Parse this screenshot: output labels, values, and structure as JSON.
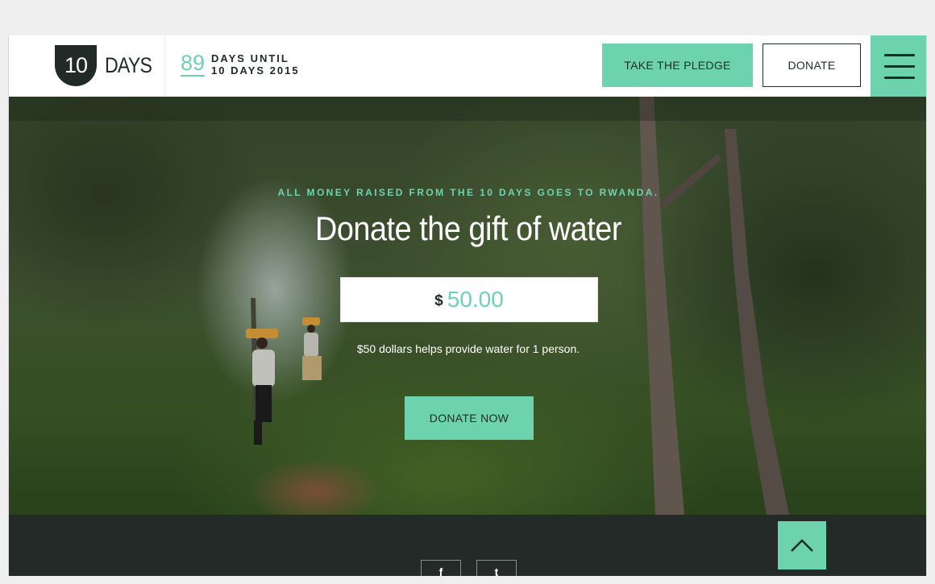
{
  "header": {
    "logo_number": "10",
    "logo_word": "DAYS",
    "countdown_number": "89",
    "countdown_line1": "DAYS UNTIL",
    "countdown_line2": "10 DAYS 2015",
    "pledge_label": "TAKE THE PLEDGE",
    "donate_label": "DONATE",
    "menu_icon": "hamburger-icon"
  },
  "hero": {
    "kicker": "ALL MONEY RAISED FROM THE 10 DAYS GOES TO RWANDA.",
    "title": "Donate the gift of water",
    "currency_symbol": "$",
    "amount": "50.00",
    "note": "$50 dollars helps provide water for 1 person.",
    "donate_now_label": "DONATE NOW"
  },
  "footer": {
    "back_to_top_icon": "chevron-up-icon",
    "social_icons": [
      "facebook-icon",
      "twitter-icon"
    ]
  },
  "colors": {
    "accent": "#6dd3ae",
    "dark": "#222a27",
    "footer_bg": "#232a28"
  }
}
